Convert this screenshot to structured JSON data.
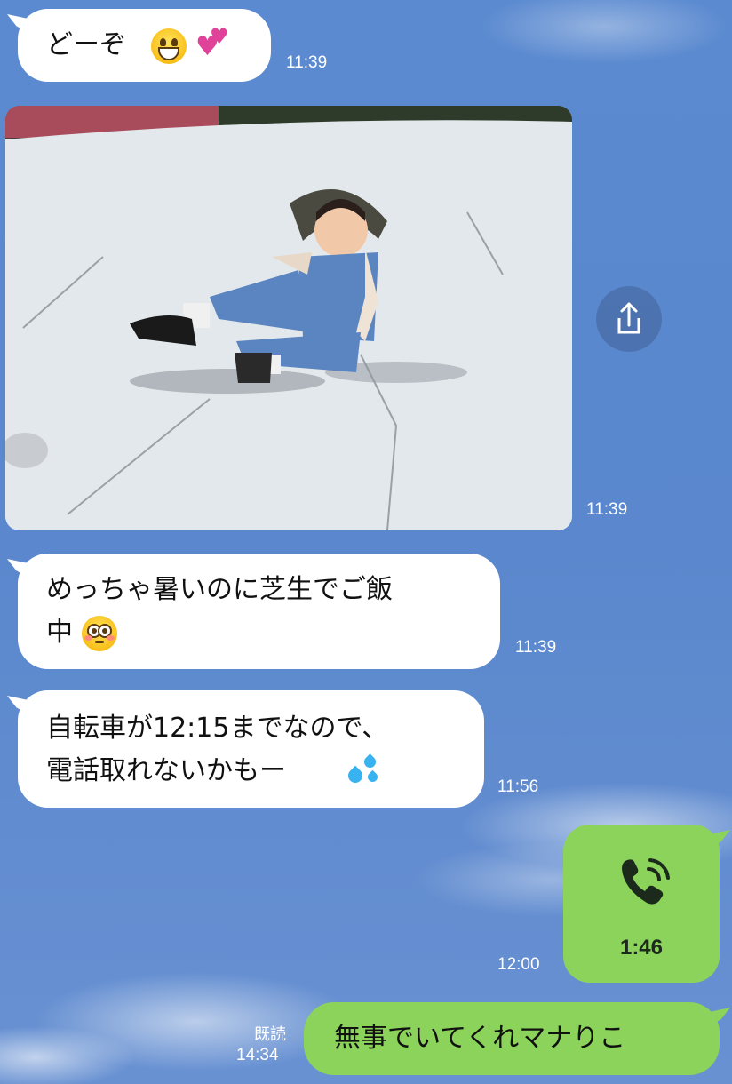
{
  "messages": [
    {
      "text": "どーぞ",
      "time": "11:39"
    },
    {
      "time": "11:39"
    },
    {
      "line1": "めっちゃ暑いのに芝生でご飯",
      "line2": "中",
      "time": "11:39"
    },
    {
      "line1": "自転車が12:15までなので、",
      "line2": "電話取れないかもー",
      "time": "11:56"
    },
    {
      "call_duration": "1:46",
      "time": "12:00"
    },
    {
      "text": "無事でいてくれマナりこ",
      "read_label": "既読",
      "time": "14:34"
    }
  ],
  "icons": {
    "msg1": [
      "grinning-face-emoji",
      "two-hearts-emoji"
    ],
    "msg2": [
      "share-icon"
    ],
    "msg3": [
      "flushed-face-emoji"
    ],
    "msg4": [
      "sweat-droplets-emoji"
    ],
    "msg5": [
      "phone-call-icon"
    ]
  },
  "colors": {
    "incoming_bubble": "#ffffff",
    "outgoing_bubble": "#8bd35a",
    "background": "#5b8ad0"
  }
}
